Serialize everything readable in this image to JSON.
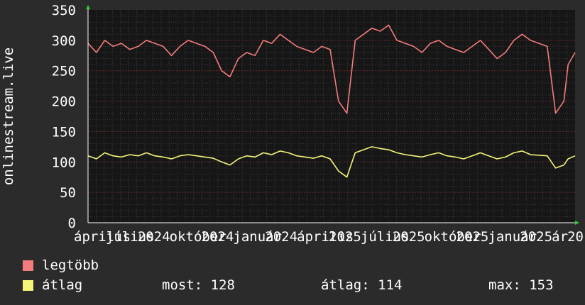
{
  "chart_data": {
    "type": "line",
    "ylabel": "onlinestream.live",
    "ylim": [
      0,
      350
    ],
    "yticks": [
      0,
      50,
      100,
      150,
      200,
      250,
      300,
      350
    ],
    "xticklabels": [
      "április",
      "július",
      "2024",
      "október",
      "2024",
      "január",
      "2024",
      "április",
      "2025",
      "július",
      "2025",
      "október",
      "2025",
      "január",
      "2025",
      "ár",
      "20"
    ],
    "grid": true,
    "x": [
      0,
      12,
      24,
      36,
      48,
      60,
      72,
      84,
      96,
      108,
      120,
      132,
      144,
      156,
      168,
      180,
      192,
      204,
      216,
      228,
      240,
      252,
      264,
      276,
      288,
      300,
      312,
      324,
      336,
      348,
      360,
      372,
      384,
      396,
      408,
      420,
      432,
      444,
      456,
      468,
      480,
      492,
      504,
      516,
      528,
      540,
      552,
      564,
      576,
      588,
      600,
      612,
      624,
      636,
      660,
      672,
      684,
      690,
      700
    ],
    "series": [
      {
        "name": "legtöbb",
        "color": "#f47c7c",
        "values": [
          295,
          280,
          300,
          290,
          295,
          285,
          290,
          300,
          295,
          290,
          275,
          290,
          300,
          295,
          290,
          280,
          250,
          240,
          270,
          280,
          275,
          300,
          295,
          310,
          300,
          290,
          285,
          280,
          290,
          285,
          200,
          180,
          300,
          310,
          320,
          315,
          325,
          300,
          295,
          290,
          280,
          295,
          300,
          290,
          285,
          280,
          290,
          300,
          285,
          270,
          280,
          300,
          310,
          300,
          290,
          180,
          200,
          260,
          280
        ]
      },
      {
        "name": "átlag",
        "color": "#f5f57a",
        "values": [
          110,
          105,
          115,
          110,
          108,
          112,
          110,
          115,
          110,
          108,
          105,
          110,
          112,
          110,
          108,
          106,
          100,
          95,
          105,
          110,
          108,
          115,
          112,
          118,
          115,
          110,
          108,
          106,
          110,
          105,
          85,
          75,
          115,
          120,
          125,
          122,
          120,
          115,
          112,
          110,
          108,
          112,
          115,
          110,
          108,
          105,
          110,
          115,
          110,
          105,
          108,
          115,
          118,
          112,
          110,
          90,
          95,
          105,
          110
        ]
      }
    ]
  },
  "legend": {
    "max_label": "legtöbb",
    "avg_label": "átlag",
    "now_text": "most: 128",
    "avg_text": "átlag: 114",
    "max_text": "max: 153"
  }
}
